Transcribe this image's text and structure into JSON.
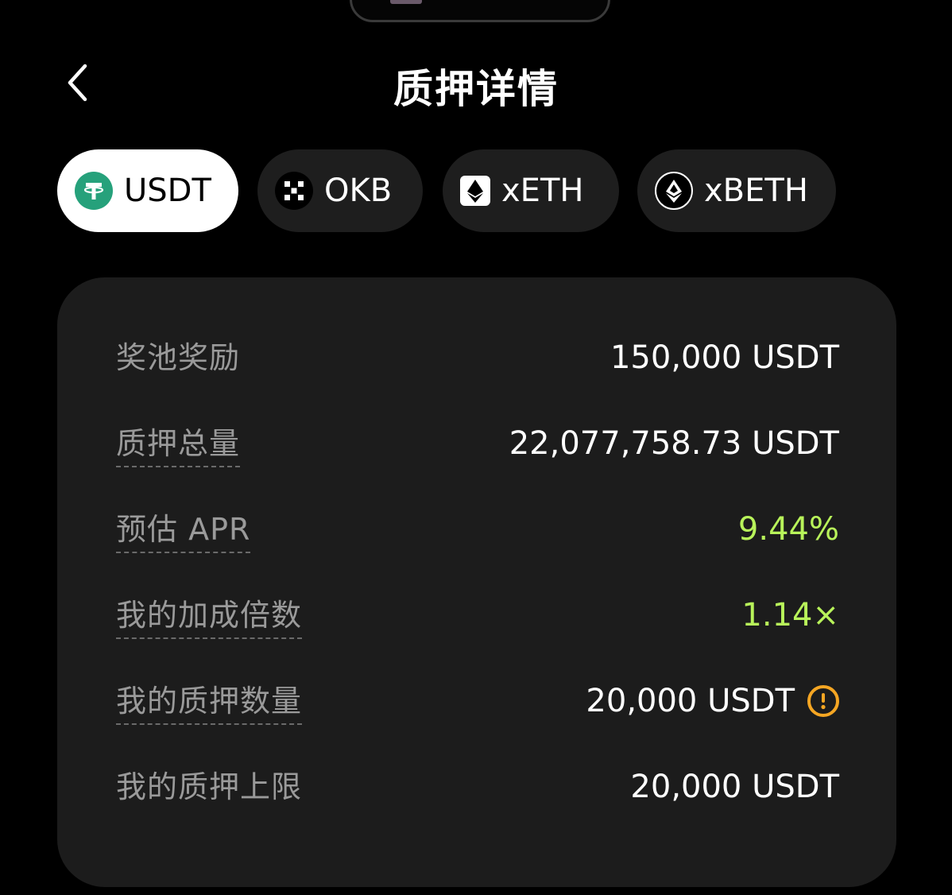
{
  "header": {
    "title": "质押详情",
    "back_icon": "chevron-left-icon"
  },
  "tabs": [
    {
      "label": "USDT",
      "icon": "tether-icon",
      "active": true,
      "icon_color": "#26a17b"
    },
    {
      "label": "OKB",
      "icon": "okb-icon",
      "active": false
    },
    {
      "label": "xETH",
      "icon": "ethereum-icon",
      "active": false
    },
    {
      "label": "xBETH",
      "icon": "beth-icon",
      "active": false
    }
  ],
  "details": [
    {
      "label": "奖池奖励",
      "value": "150,000 USDT"
    },
    {
      "label": "质押总量",
      "value": "22,077,758.73 USDT"
    },
    {
      "label": "预估 APR",
      "value": "9.44%"
    },
    {
      "label": "我的加成倍数",
      "value": "1.14×"
    },
    {
      "label": "我的质押数量",
      "value": "20,000 USDT",
      "icon": "warning-icon"
    },
    {
      "label": "我的质押上限",
      "value": "20,000 USDT"
    }
  ],
  "colors": {
    "background": "#000000",
    "card": "#1c1c1c",
    "positive": "#b8f35a",
    "warning": "#f5a623",
    "tether": "#26a17b"
  }
}
